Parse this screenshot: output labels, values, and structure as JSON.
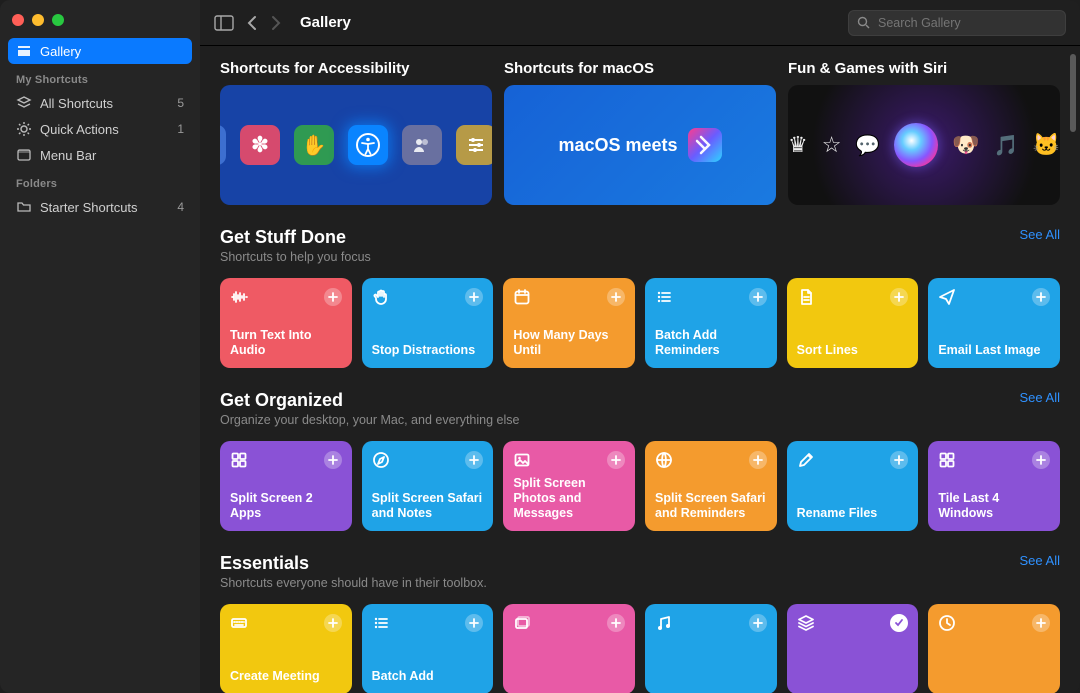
{
  "sidebar": {
    "gallery_label": "Gallery",
    "my_shortcuts_label": "My Shortcuts",
    "all_shortcuts_label": "All Shortcuts",
    "all_shortcuts_count": "5",
    "quick_actions_label": "Quick Actions",
    "quick_actions_count": "1",
    "menu_bar_label": "Menu Bar",
    "folders_label": "Folders",
    "starter_label": "Starter Shortcuts",
    "starter_count": "4"
  },
  "toolbar": {
    "title": "Gallery",
    "search_placeholder": "Search Gallery"
  },
  "banners": [
    {
      "title": "Shortcuts for Accessibility"
    },
    {
      "title": "Shortcuts for macOS",
      "mac_text": "macOS meets"
    },
    {
      "title": "Fun & Games with Siri"
    }
  ],
  "see_all_label": "See All",
  "sections": [
    {
      "title": "Get Stuff Done",
      "subtitle": "Shortcuts to help you focus",
      "tiles": [
        {
          "label": "Turn Text Into Audio",
          "color": "#ef5a64",
          "icon": "waveform-icon"
        },
        {
          "label": "Stop Distractions",
          "color": "#1fa3e7",
          "icon": "hand-icon"
        },
        {
          "label": "How Many Days Until",
          "color": "#f49b2e",
          "icon": "calendar-icon"
        },
        {
          "label": "Batch Add Reminders",
          "color": "#1fa3e7",
          "icon": "list-icon"
        },
        {
          "label": "Sort Lines",
          "color": "#f2c80f",
          "icon": "document-icon"
        },
        {
          "label": "Email Last Image",
          "color": "#1fa3e7",
          "icon": "paperplane-icon"
        }
      ]
    },
    {
      "title": "Get Organized",
      "subtitle": "Organize your desktop, your Mac, and everything else",
      "tiles": [
        {
          "label": "Split Screen 2 Apps",
          "color": "#8a52d6",
          "icon": "grid4-icon"
        },
        {
          "label": "Split Screen Safari and Notes",
          "color": "#1fa3e7",
          "icon": "compass-icon"
        },
        {
          "label": "Split Screen Photos and Messages",
          "color": "#e85aa6",
          "icon": "photo-icon"
        },
        {
          "label": "Split Screen Safari and Reminders",
          "color": "#f49b2e",
          "icon": "globe-icon"
        },
        {
          "label": "Rename Files",
          "color": "#1fa3e7",
          "icon": "pencil-icon"
        },
        {
          "label": "Tile Last 4 Windows",
          "color": "#8a52d6",
          "icon": "grid4-icon"
        }
      ]
    },
    {
      "title": "Essentials",
      "subtitle": "Shortcuts everyone should have in their toolbox.",
      "tiles": [
        {
          "label": "Create Meeting",
          "color": "#f2c80f",
          "icon": "keyboard-icon"
        },
        {
          "label": "Batch Add",
          "color": "#1fa3e7",
          "icon": "list-icon"
        },
        {
          "label": "",
          "color": "#e85aa6",
          "icon": "photos-icon"
        },
        {
          "label": "",
          "color": "#1fa3e7",
          "icon": "music-icon"
        },
        {
          "label": "",
          "color": "#8a52d6",
          "icon": "stack-icon",
          "alt_badge": true
        },
        {
          "label": "",
          "color": "#f49b2e",
          "icon": "clock-icon"
        }
      ]
    }
  ]
}
